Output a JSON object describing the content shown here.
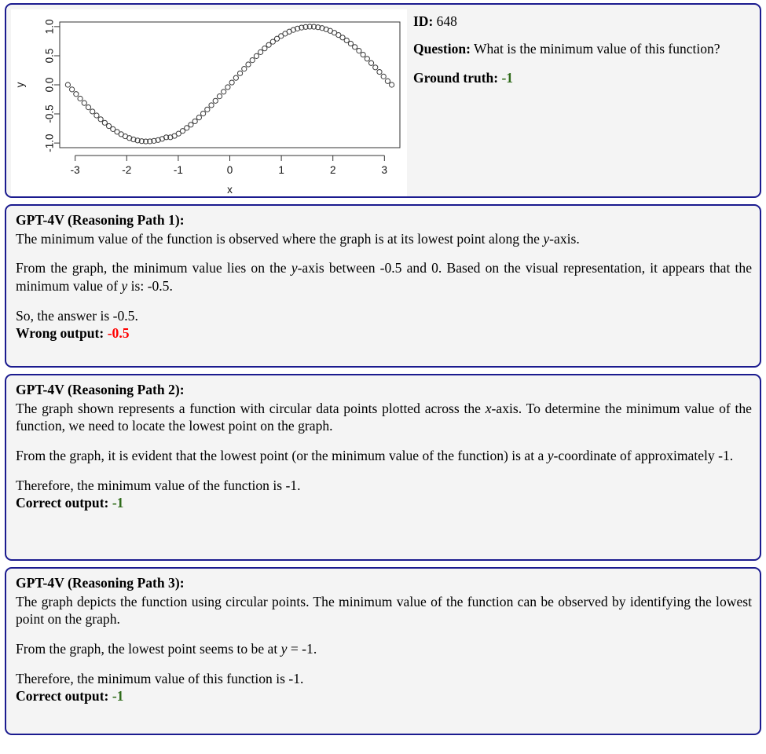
{
  "header": {
    "id_label": "ID:",
    "id_value": "648",
    "question_label": "Question:",
    "question_text": "What is the minimum value of this function?",
    "ground_truth_label": "Ground truth:",
    "ground_truth_value": "-1",
    "colors": {
      "border": "#1b1b8f",
      "card_bg": "#f4f4f4",
      "correct": "#2f6b1a",
      "wrong": "#ff0000"
    }
  },
  "chart_data": {
    "type": "scatter",
    "title": "",
    "xlabel": "x",
    "ylabel": "y",
    "xlim": [
      -3.3,
      3.3
    ],
    "ylim": [
      -1.08,
      1.08
    ],
    "xticks": [
      -3,
      -2,
      -1,
      0,
      1,
      2,
      3
    ],
    "xticklabels": [
      "-3",
      "-2",
      "-1",
      "0",
      "1",
      "2",
      "3"
    ],
    "yticks": [
      -1.0,
      -0.5,
      0.0,
      0.5,
      1.0
    ],
    "yticklabels": [
      "-1.0",
      "-0.5",
      "0.0",
      "0.5",
      "1.0"
    ],
    "grid": false,
    "legend": null,
    "marker": "open-circle",
    "marker_color": "#3a3a3a",
    "function": "y = sin(x)",
    "n_points": 80,
    "x": [
      -3.1416,
      -3.0621,
      -2.9825,
      -2.903,
      -2.8234,
      -2.7439,
      -2.6644,
      -2.5848,
      -2.5053,
      -2.4257,
      -2.3462,
      -2.2667,
      -2.1871,
      -2.1076,
      -2.028,
      -1.9485,
      -1.869,
      -1.7894,
      -1.7099,
      -1.6303,
      -1.5508,
      -1.4713,
      -1.3917,
      -1.3122,
      -1.2326,
      -1.1531,
      -1.0736,
      -0.994,
      -0.9145,
      -0.8349,
      -0.7554,
      -0.6759,
      -0.5963,
      -0.5168,
      -0.4372,
      -0.3577,
      -0.2782,
      -0.1986,
      -0.1191,
      -0.0395,
      0.04,
      0.1196,
      0.1991,
      0.2786,
      0.3582,
      0.4377,
      0.5173,
      0.5968,
      0.6763,
      0.7559,
      0.8354,
      0.915,
      0.9945,
      1.074,
      1.1536,
      1.2331,
      1.3127,
      1.3922,
      1.4717,
      1.5513,
      1.6308,
      1.7104,
      1.7899,
      1.8694,
      1.949,
      2.0285,
      2.1081,
      2.1876,
      2.2671,
      2.3467,
      2.4262,
      2.5058,
      2.5853,
      2.6648,
      2.7444,
      2.8239,
      2.9035,
      2.983,
      3.0625,
      3.1416
    ],
    "y": [
      -0.0,
      -0.0795,
      -0.1584,
      -0.2363,
      -0.3125,
      -0.3866,
      -0.4582,
      -0.5266,
      -0.5915,
      -0.6525,
      -0.7091,
      -0.7609,
      -0.8078,
      -0.8492,
      -0.885,
      -0.9149,
      -0.9387,
      -0.9563,
      -0.9676,
      -0.9725,
      -0.971,
      -0.9632,
      -0.949,
      -0.9286,
      -0.9022,
      -0.9022,
      -0.8786,
      -0.8387,
      -0.7925,
      -0.7407,
      -0.6856,
      -0.6271,
      -0.5615,
      -0.4941,
      -0.4232,
      -0.3501,
      -0.2746,
      -0.1973,
      -0.1188,
      -0.0395,
      0.04,
      0.1193,
      0.198,
      0.275,
      0.3506,
      0.4239,
      0.4943,
      0.5619,
      0.6257,
      0.6857,
      0.7408,
      0.7929,
      0.8388,
      0.879,
      0.9144,
      0.9437,
      0.9673,
      0.9842,
      0.995,
      0.9999,
      0.9979,
      0.9898,
      0.9755,
      0.9544,
      0.9278,
      0.8949,
      0.856,
      0.8124,
      0.7631,
      0.7084,
      0.6501,
      0.5859,
      0.5186,
      0.4484,
      0.3742,
      0.2995,
      0.2217,
      0.1436,
      0.0638,
      0.0
    ]
  },
  "reasoning_paths": [
    {
      "title": "GPT-4V (Reasoning Path 1):",
      "paragraphs": [
        "The minimum value of the function is observed where the graph is at its lowest point along the y-axis.",
        "From the graph, the minimum value lies on the y-axis between -0.5 and 0.  Based on the visual representation, it appears that the minimum value of y is: -0.5.",
        "So, the answer is -0.5."
      ],
      "outcome_label": "Wrong output:",
      "outcome_value": "-0.5",
      "outcome_kind": "wrong"
    },
    {
      "title": "GPT-4V (Reasoning Path 2):",
      "paragraphs": [
        "The graph shown represents a function with circular data points plotted across the x-axis.  To determine the minimum value of the function, we need to locate the lowest point on the graph.",
        "From the graph, it is evident that the lowest point (or the minimum value of the function) is at a y-coordinate of approximately -1.",
        "Therefore, the minimum value of the function is -1."
      ],
      "outcome_label": "Correct output:",
      "outcome_value": "-1",
      "outcome_kind": "correct"
    },
    {
      "title": "GPT-4V (Reasoning Path 3):",
      "paragraphs": [
        "The graph depicts the function using circular points.  The minimum value of the function can be observed by identifying the lowest point on the graph.",
        "From the graph, the lowest point seems to be at y = -1.",
        "Therefore, the minimum value of this function is -1."
      ],
      "outcome_label": "Correct output:",
      "outcome_value": "-1",
      "outcome_kind": "correct"
    }
  ]
}
